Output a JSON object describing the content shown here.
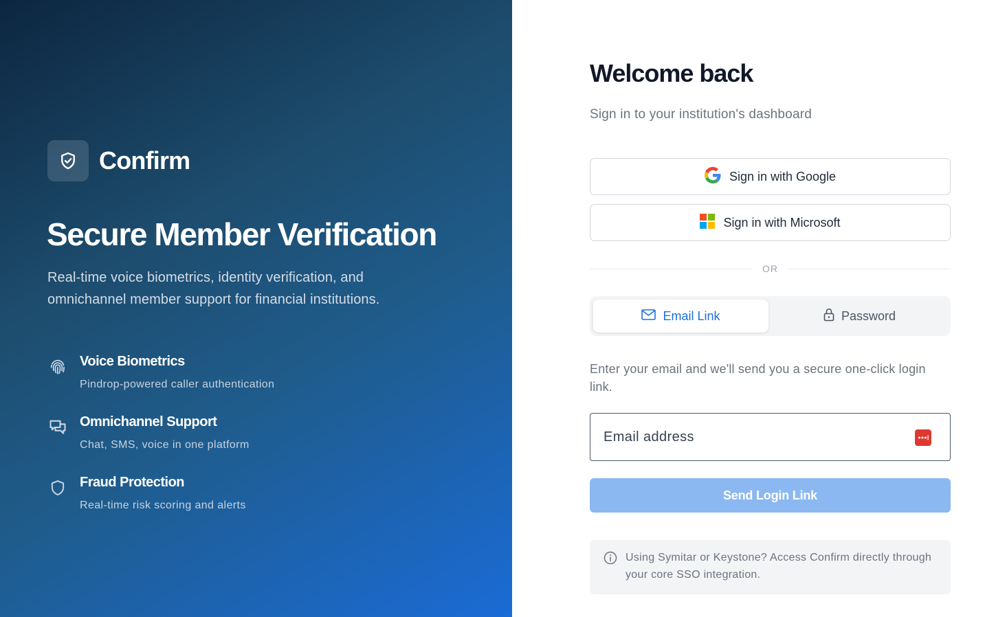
{
  "brand": {
    "name": "Confirm",
    "logo_icon": "shield-check-icon"
  },
  "hero": {
    "title": "Secure Member Verification",
    "subtitle": "Real-time voice biometrics, identity verification, and omnichannel member support for financial institutions."
  },
  "features": [
    {
      "icon": "fingerprint-icon",
      "title": "Voice Biometrics",
      "description": "Pindrop-powered caller authentication"
    },
    {
      "icon": "chat-icon",
      "title": "Omnichannel Support",
      "description": "Chat, SMS, voice in one platform"
    },
    {
      "icon": "shield-icon",
      "title": "Fraud Protection",
      "description": "Real-time risk scoring and alerts"
    }
  ],
  "login": {
    "title": "Welcome back",
    "subtitle": "Sign in to your institution's dashboard",
    "google_label": "Sign in with Google",
    "microsoft_label": "Sign in with Microsoft",
    "divider_text": "OR",
    "tabs": [
      {
        "label": "Email Link",
        "icon": "mail-icon",
        "active": true
      },
      {
        "label": "Password",
        "icon": "lock-icon",
        "active": false
      }
    ],
    "instructions": "Enter your email and we'll send you a secure one-click login link.",
    "email_placeholder": "Email address",
    "email_value": "",
    "send_label": "Send Login Link",
    "info_text": "Using Symitar or Keystone? Access Confirm directly through your core SSO integration."
  },
  "colors": {
    "accent": "#1e6fd9",
    "send_button": "#8cb8f2",
    "password_manager": "#dc3a30"
  }
}
